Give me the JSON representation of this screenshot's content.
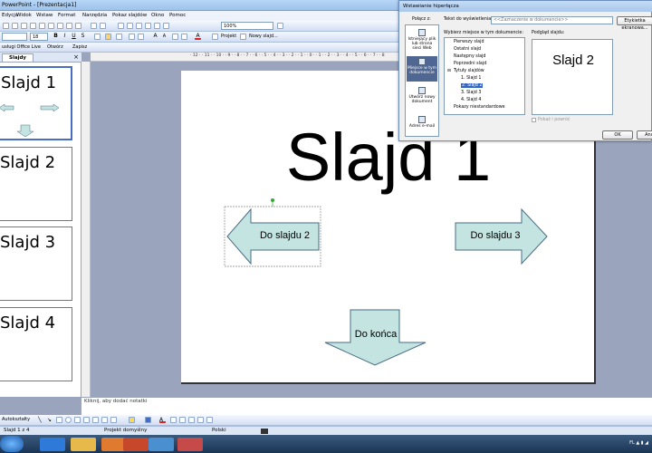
{
  "window": {
    "title": "PowerPoint - [Prezentacja1]"
  },
  "menu": [
    "Edycja",
    "Widok",
    "Wstaw",
    "Format",
    "Narzędzia",
    "Pokaz slajdów",
    "Okno",
    "Pomoc"
  ],
  "toolbar": {
    "zoom": "100%",
    "font_size": "18",
    "design_label": "Projekt",
    "new_slide_label": "Nowy slajd...",
    "office_live_label": "usługi Office Live",
    "open_label": "Otwórz",
    "save_label": "Zapisz"
  },
  "slides_pane": {
    "tab_label": "Slajdy",
    "thumbnails": [
      "Slajd 1",
      "Slajd 2",
      "Slajd 3",
      "Slajd 4"
    ]
  },
  "slide": {
    "title": "Slajd 1",
    "left_arrow": "Do slajdu 2",
    "right_arrow": "Do slajdu 3",
    "down_arrow": "Do końca"
  },
  "notes_placeholder": "Kliknij, aby dodać notatki",
  "status": {
    "slide": "Slajd 1 z 4",
    "design": "Projekt domyślny",
    "language": "Polski"
  },
  "drawbar": {
    "autoshapes": "Autokształty"
  },
  "dialog": {
    "title": "Wstawianie hiperłącza",
    "link_to_label": "Połącz z:",
    "text_to_display_label": "Tekst do wyświetlenia:",
    "text_to_display_value": "<<Zaznaczenie w dokumencie>>",
    "screentip_button": "Etykietka ekranowa...",
    "select_place_label": "Wybierz miejsce w tym dokumencie:",
    "preview_label": "Podgląd slajdu:",
    "link_options": [
      "Istniejący plik lub strona sieci Web",
      "Miejsce w tym dokumencie",
      "Utwórz nowy dokument",
      "Adres e-mail"
    ],
    "places": [
      "Pierwszy slajd",
      "Ostatni slajd",
      "Następny slajd",
      "Poprzedni slajd",
      "Tytuły slajdów",
      "1. Slajd 1",
      "2. Slajd 2",
      "3. Slajd 3",
      "4. Slajd 4",
      "Pokazy niestandardowe"
    ],
    "preview_text": "Slajd 2",
    "show_return_label": "Pokaż i powróć",
    "ok_button": "OK",
    "cancel_button": "Anuluj"
  },
  "colors": {
    "arrow_fill": "#c3e4e1",
    "arrow_stroke": "#4a6c82",
    "selection": "#4f6792"
  }
}
